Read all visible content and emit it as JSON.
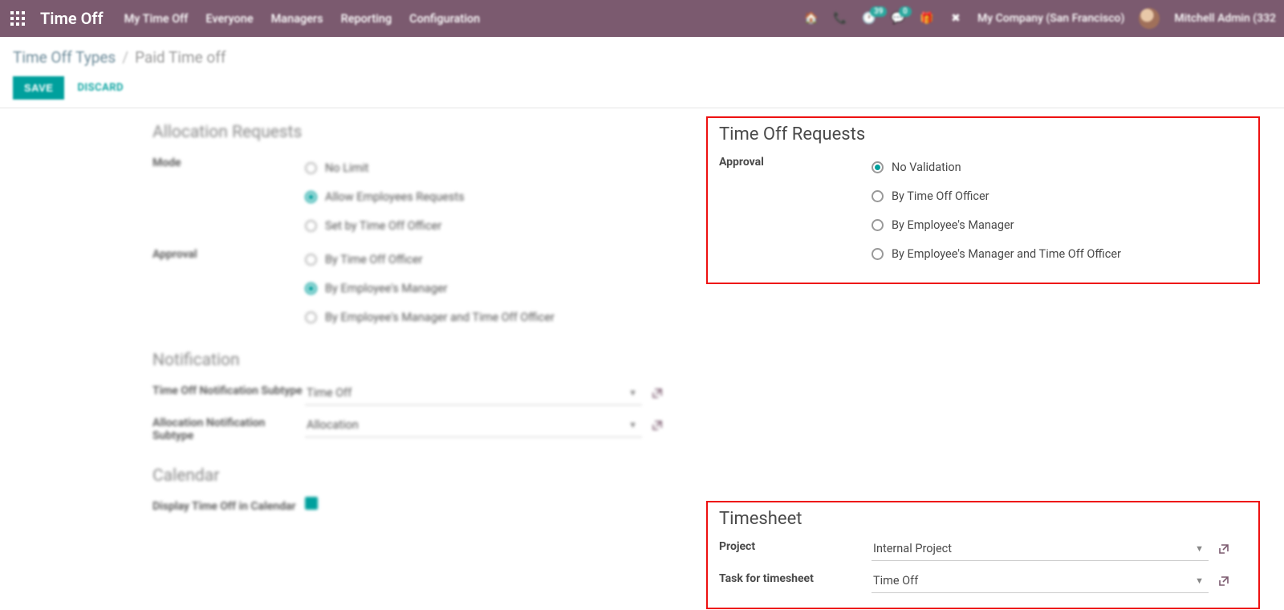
{
  "topbar": {
    "app_title": "Time Off",
    "nav": [
      "My Time Off",
      "Everyone",
      "Managers",
      "Reporting",
      "Configuration"
    ],
    "badge1": "39",
    "badge2": "0",
    "company": "My Company (San Francisco)",
    "user": "Mitchell Admin (332"
  },
  "breadcrumb": {
    "parent": "Time Off Types",
    "current": "Paid Time off"
  },
  "buttons": {
    "save": "SAVE",
    "discard": "DISCARD"
  },
  "left": {
    "allocation": {
      "title": "Allocation Requests",
      "mode_label": "Mode",
      "mode_options": [
        "No Limit",
        "Allow Employees Requests",
        "Set by Time Off Officer"
      ],
      "mode_selected": 1,
      "approval_label": "Approval",
      "approval_options": [
        "By Time Off Officer",
        "By Employee's Manager",
        "By Employee's Manager and Time Off Officer"
      ],
      "approval_selected": 1
    },
    "notification": {
      "title": "Notification",
      "row1_label": "Time Off Notification Subtype",
      "row1_value": "Time Off",
      "row2_label": "Allocation Notification Subtype",
      "row2_value": "Allocation"
    },
    "calendar": {
      "title": "Calendar",
      "row1_label": "Display Time Off in Calendar"
    }
  },
  "right": {
    "requests": {
      "title": "Time Off Requests",
      "approval_label": "Approval",
      "options": [
        "No Validation",
        "By Time Off Officer",
        "By Employee's Manager",
        "By Employee's Manager and Time Off Officer"
      ],
      "selected": 0
    },
    "timesheet": {
      "title": "Timesheet",
      "project_label": "Project",
      "project_value": "Internal Project",
      "task_label": "Task for timesheet",
      "task_value": "Time Off"
    }
  }
}
